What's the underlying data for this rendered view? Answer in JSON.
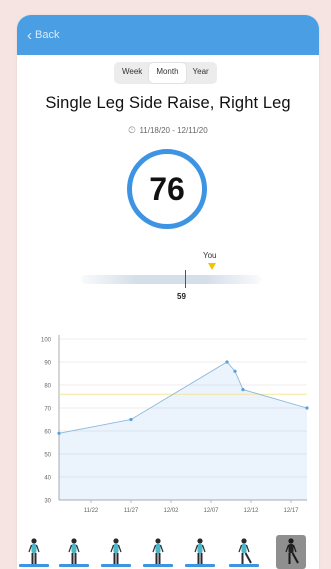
{
  "nav": {
    "back_label": "Back"
  },
  "segments": [
    {
      "label": "Week",
      "active": false
    },
    {
      "label": "Month",
      "active": true
    },
    {
      "label": "Year",
      "active": false
    }
  ],
  "title": "Single Leg Side Raise, Right Leg",
  "date_range": "11/18/20 - 12/11/20",
  "score": "76",
  "you_label": "You",
  "range_value": "59",
  "colors": {
    "accent": "#3d94e2",
    "nav": "#4a9ee3",
    "marker": "#f2c400"
  },
  "chart_data": {
    "type": "area",
    "x_ticks": [
      "11/22",
      "11/27",
      "12/02",
      "12/07",
      "12/12",
      "12/17"
    ],
    "y_ticks": [
      "100",
      "90",
      "80",
      "70",
      "60",
      "50",
      "40",
      "30"
    ],
    "ylim": [
      30,
      100
    ],
    "reference_line": 76,
    "points": [
      {
        "day": 0,
        "value": 59
      },
      {
        "day": 9,
        "value": 65
      },
      {
        "day": 21,
        "value": 90
      },
      {
        "day": 22,
        "value": 86
      },
      {
        "day": 23,
        "value": 78
      },
      {
        "day": 31,
        "value": 70
      }
    ],
    "x_tick_days": [
      4,
      9,
      14,
      19,
      24,
      29
    ],
    "xlim": [
      0,
      31
    ]
  },
  "thumbnails": [
    {
      "icon": "standing-pose-icon",
      "selected": false
    },
    {
      "icon": "standing-pose-icon",
      "selected": false
    },
    {
      "icon": "standing-pose-icon",
      "selected": false
    },
    {
      "icon": "standing-pose-icon",
      "selected": false
    },
    {
      "icon": "standing-pose-icon",
      "selected": false
    },
    {
      "icon": "side-raise-pose-icon",
      "selected": false
    },
    {
      "icon": "side-raise-pose-icon",
      "selected": true
    }
  ]
}
